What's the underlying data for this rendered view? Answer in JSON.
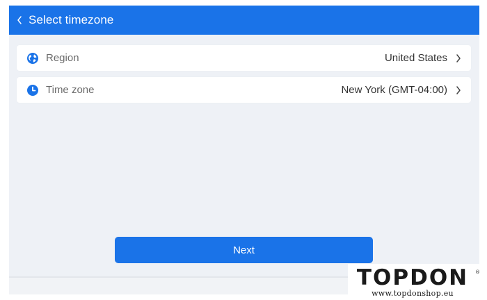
{
  "header": {
    "title": "Select timezone",
    "back_icon": "chevron-left-icon"
  },
  "settings": [
    {
      "label": "Region",
      "value": "United States",
      "icon": "globe-icon"
    },
    {
      "label": "Time zone",
      "value": "New York (GMT-04:00)",
      "icon": "clock-icon"
    }
  ],
  "next_button": {
    "label": "Next"
  },
  "watermark": {
    "brand": "TOPDON",
    "url": "www.topdonshop.eu"
  },
  "colors": {
    "accent": "#1a73e8",
    "background": "#eef1f6"
  }
}
